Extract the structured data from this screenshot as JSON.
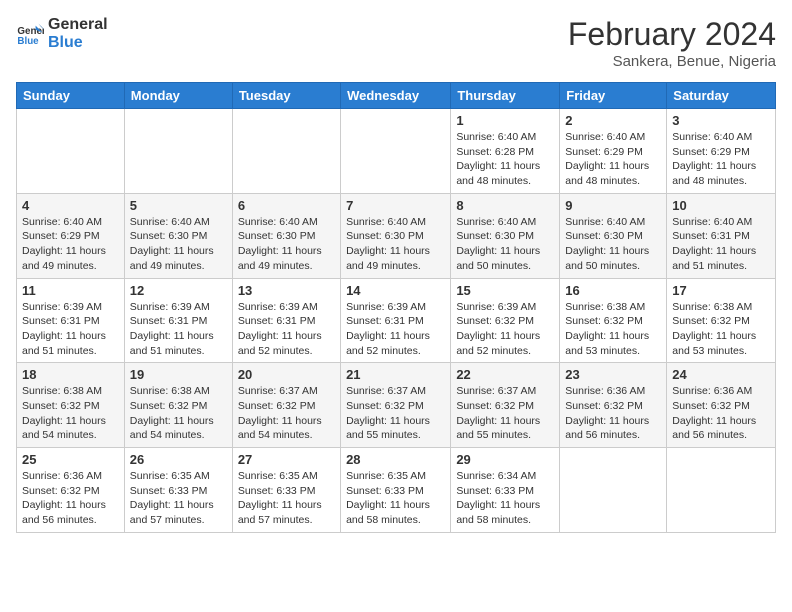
{
  "logo": {
    "line1": "General",
    "line2": "Blue"
  },
  "title": "February 2024",
  "subtitle": "Sankera, Benue, Nigeria",
  "days_of_week": [
    "Sunday",
    "Monday",
    "Tuesday",
    "Wednesday",
    "Thursday",
    "Friday",
    "Saturday"
  ],
  "weeks": [
    [
      {
        "day": "",
        "info": ""
      },
      {
        "day": "",
        "info": ""
      },
      {
        "day": "",
        "info": ""
      },
      {
        "day": "",
        "info": ""
      },
      {
        "day": "1",
        "info": "Sunrise: 6:40 AM\nSunset: 6:28 PM\nDaylight: 11 hours and 48 minutes."
      },
      {
        "day": "2",
        "info": "Sunrise: 6:40 AM\nSunset: 6:29 PM\nDaylight: 11 hours and 48 minutes."
      },
      {
        "day": "3",
        "info": "Sunrise: 6:40 AM\nSunset: 6:29 PM\nDaylight: 11 hours and 48 minutes."
      }
    ],
    [
      {
        "day": "4",
        "info": "Sunrise: 6:40 AM\nSunset: 6:29 PM\nDaylight: 11 hours and 49 minutes."
      },
      {
        "day": "5",
        "info": "Sunrise: 6:40 AM\nSunset: 6:30 PM\nDaylight: 11 hours and 49 minutes."
      },
      {
        "day": "6",
        "info": "Sunrise: 6:40 AM\nSunset: 6:30 PM\nDaylight: 11 hours and 49 minutes."
      },
      {
        "day": "7",
        "info": "Sunrise: 6:40 AM\nSunset: 6:30 PM\nDaylight: 11 hours and 49 minutes."
      },
      {
        "day": "8",
        "info": "Sunrise: 6:40 AM\nSunset: 6:30 PM\nDaylight: 11 hours and 50 minutes."
      },
      {
        "day": "9",
        "info": "Sunrise: 6:40 AM\nSunset: 6:30 PM\nDaylight: 11 hours and 50 minutes."
      },
      {
        "day": "10",
        "info": "Sunrise: 6:40 AM\nSunset: 6:31 PM\nDaylight: 11 hours and 51 minutes."
      }
    ],
    [
      {
        "day": "11",
        "info": "Sunrise: 6:39 AM\nSunset: 6:31 PM\nDaylight: 11 hours and 51 minutes."
      },
      {
        "day": "12",
        "info": "Sunrise: 6:39 AM\nSunset: 6:31 PM\nDaylight: 11 hours and 51 minutes."
      },
      {
        "day": "13",
        "info": "Sunrise: 6:39 AM\nSunset: 6:31 PM\nDaylight: 11 hours and 52 minutes."
      },
      {
        "day": "14",
        "info": "Sunrise: 6:39 AM\nSunset: 6:31 PM\nDaylight: 11 hours and 52 minutes."
      },
      {
        "day": "15",
        "info": "Sunrise: 6:39 AM\nSunset: 6:32 PM\nDaylight: 11 hours and 52 minutes."
      },
      {
        "day": "16",
        "info": "Sunrise: 6:38 AM\nSunset: 6:32 PM\nDaylight: 11 hours and 53 minutes."
      },
      {
        "day": "17",
        "info": "Sunrise: 6:38 AM\nSunset: 6:32 PM\nDaylight: 11 hours and 53 minutes."
      }
    ],
    [
      {
        "day": "18",
        "info": "Sunrise: 6:38 AM\nSunset: 6:32 PM\nDaylight: 11 hours and 54 minutes."
      },
      {
        "day": "19",
        "info": "Sunrise: 6:38 AM\nSunset: 6:32 PM\nDaylight: 11 hours and 54 minutes."
      },
      {
        "day": "20",
        "info": "Sunrise: 6:37 AM\nSunset: 6:32 PM\nDaylight: 11 hours and 54 minutes."
      },
      {
        "day": "21",
        "info": "Sunrise: 6:37 AM\nSunset: 6:32 PM\nDaylight: 11 hours and 55 minutes."
      },
      {
        "day": "22",
        "info": "Sunrise: 6:37 AM\nSunset: 6:32 PM\nDaylight: 11 hours and 55 minutes."
      },
      {
        "day": "23",
        "info": "Sunrise: 6:36 AM\nSunset: 6:32 PM\nDaylight: 11 hours and 56 minutes."
      },
      {
        "day": "24",
        "info": "Sunrise: 6:36 AM\nSunset: 6:32 PM\nDaylight: 11 hours and 56 minutes."
      }
    ],
    [
      {
        "day": "25",
        "info": "Sunrise: 6:36 AM\nSunset: 6:32 PM\nDaylight: 11 hours and 56 minutes."
      },
      {
        "day": "26",
        "info": "Sunrise: 6:35 AM\nSunset: 6:33 PM\nDaylight: 11 hours and 57 minutes."
      },
      {
        "day": "27",
        "info": "Sunrise: 6:35 AM\nSunset: 6:33 PM\nDaylight: 11 hours and 57 minutes."
      },
      {
        "day": "28",
        "info": "Sunrise: 6:35 AM\nSunset: 6:33 PM\nDaylight: 11 hours and 58 minutes."
      },
      {
        "day": "29",
        "info": "Sunrise: 6:34 AM\nSunset: 6:33 PM\nDaylight: 11 hours and 58 minutes."
      },
      {
        "day": "",
        "info": ""
      },
      {
        "day": "",
        "info": ""
      }
    ]
  ]
}
